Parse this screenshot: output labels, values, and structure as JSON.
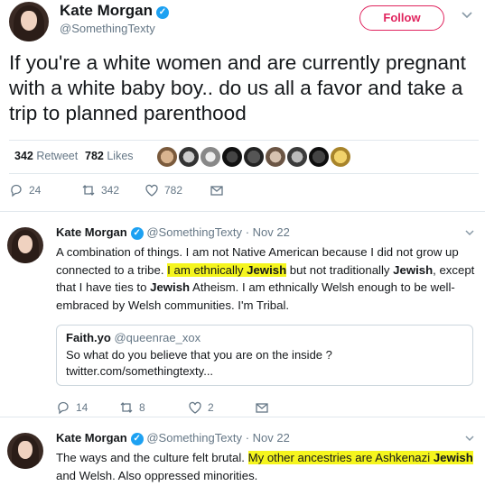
{
  "colors": {
    "accent": "#1da1f2",
    "follow": "#e0245e",
    "highlight": "#f5f51e",
    "muted": "#657786"
  },
  "main": {
    "name": "Kate Morgan",
    "handle": "@SomethingTexty",
    "follow_label": "Follow",
    "text": "If you're a white women and are currently pregnant with a white baby boy.. do us all a favor and take a trip to planned parenthood",
    "retweet_count": "342",
    "retweet_label": "Retweet",
    "likes_count": "782",
    "likes_label": "Likes",
    "actions": {
      "replies": "24",
      "retweets": "342",
      "likes": "782"
    },
    "icons": [
      "reply-icon",
      "retweet-icon",
      "like-icon",
      "dm-icon",
      "chevron-down-icon",
      "verified-icon"
    ]
  },
  "reply1": {
    "name": "Kate Morgan",
    "handle": "@SomethingTexty",
    "sep": "·",
    "date": "Nov 22",
    "t1": "A combination of things. I am not Native American because I did not grow up connected to a tribe. ",
    "t2": "I am ethnically ",
    "t3": "Jewish",
    "t4": " but not traditionally ",
    "t5": "Jewish",
    "t6": ", except that I have ties to ",
    "t7": "Jewish",
    "t8": " Atheism. I am ethnically Welsh enough to be well-embraced by Welsh communities. I'm Tribal.",
    "quote": {
      "name": "Faith.yo",
      "handle": "@queenrae_xox",
      "text": "So what do you believe that you are on the inside ?",
      "link": "twitter.com/somethingtexty..."
    },
    "actions": {
      "replies": "14",
      "retweets": "8",
      "likes": "2"
    }
  },
  "reply2": {
    "name": "Kate Morgan",
    "handle": "@SomethingTexty",
    "sep": "·",
    "date": "Nov 22",
    "t1": "The ways and the culture felt brutal. ",
    "t2": "My other ancestries are Ashkenazi ",
    "t3": "Jewish",
    "t4": " and Welsh. Also oppressed minorities."
  }
}
